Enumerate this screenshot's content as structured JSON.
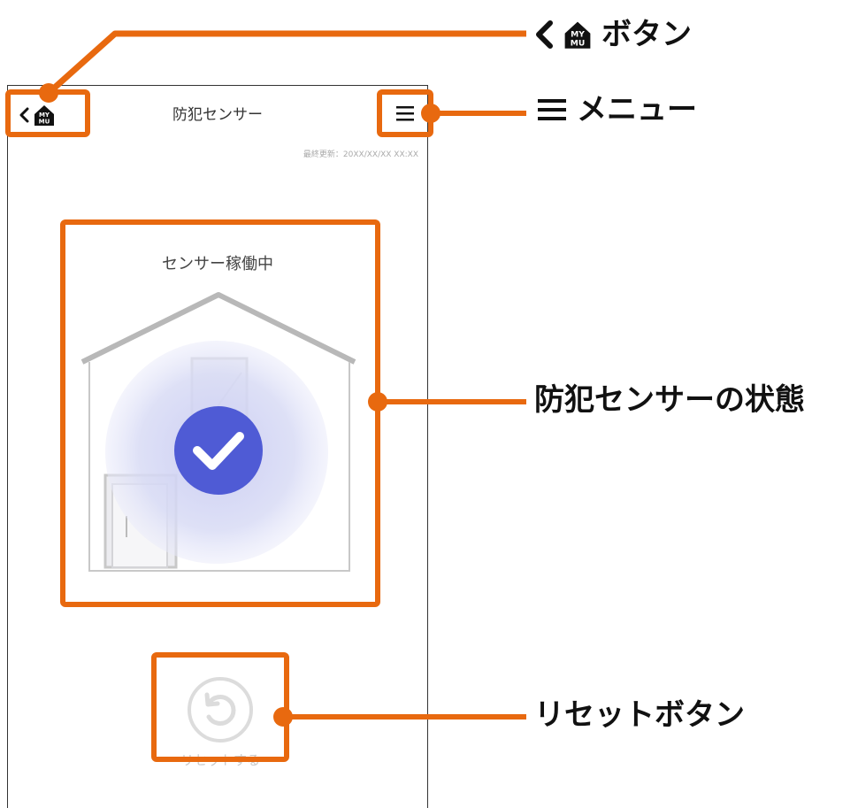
{
  "app": {
    "header_title": "防犯センサー",
    "last_updated": "最終更新：20XX/XX/XX XX:XX",
    "home_badge_text_top": "MY",
    "home_badge_text_bottom": "MU"
  },
  "status": {
    "label": "センサー稼働中",
    "state": "active",
    "check_color": "#4f5bd5"
  },
  "reset": {
    "label": "リセットする",
    "enabled": false
  },
  "annotations": {
    "back_button": "ボタン",
    "menu": "メニュー",
    "sensor_status": "防犯センサーの状態",
    "reset_button": "リセットボタン"
  },
  "colors": {
    "highlight": "#e8690f",
    "check": "#4f5bd5",
    "text": "#333333"
  }
}
